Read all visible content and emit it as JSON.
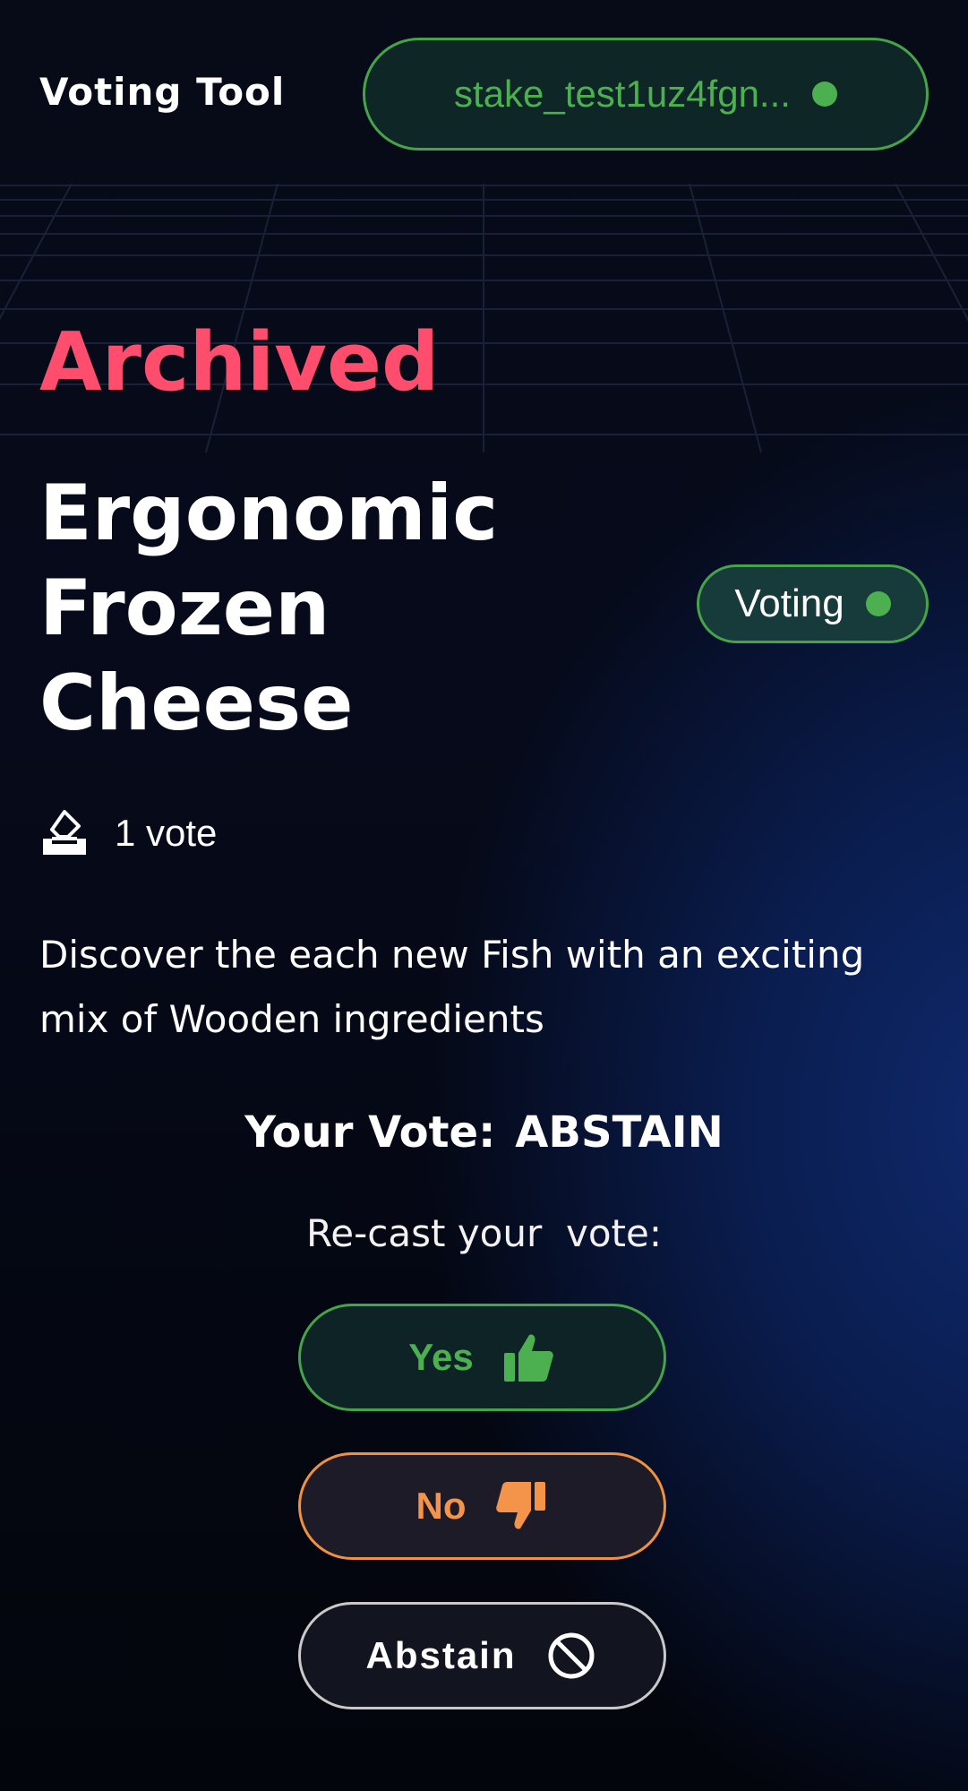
{
  "header": {
    "app_title": "Voting Tool",
    "wallet_address": "stake_test1uz4fgn..."
  },
  "proposal": {
    "status": "Archived",
    "title": "Ergonomic Frozen Cheese",
    "badge_label": "Voting",
    "vote_count": "1 vote",
    "description": "Discover the each new Fish with an exciting mix of Wooden ingredients"
  },
  "vote": {
    "your_vote_label": "Your Vote:",
    "your_vote_value": "ABSTAIN",
    "recast_label": "Re-cast your  vote:",
    "options": {
      "yes": "Yes",
      "no": "No",
      "abstain": "Abstain"
    }
  },
  "colors": {
    "accent_green": "#4cb050",
    "archived_red": "#ff4d6d",
    "no_orange": "#f4944a",
    "background": "#05070f"
  },
  "icons": {
    "wallet_status": "status-dot-icon",
    "votes": "ballot-box-icon",
    "yes": "thumbs-up-icon",
    "no": "thumbs-down-icon",
    "abstain": "ban-icon"
  }
}
